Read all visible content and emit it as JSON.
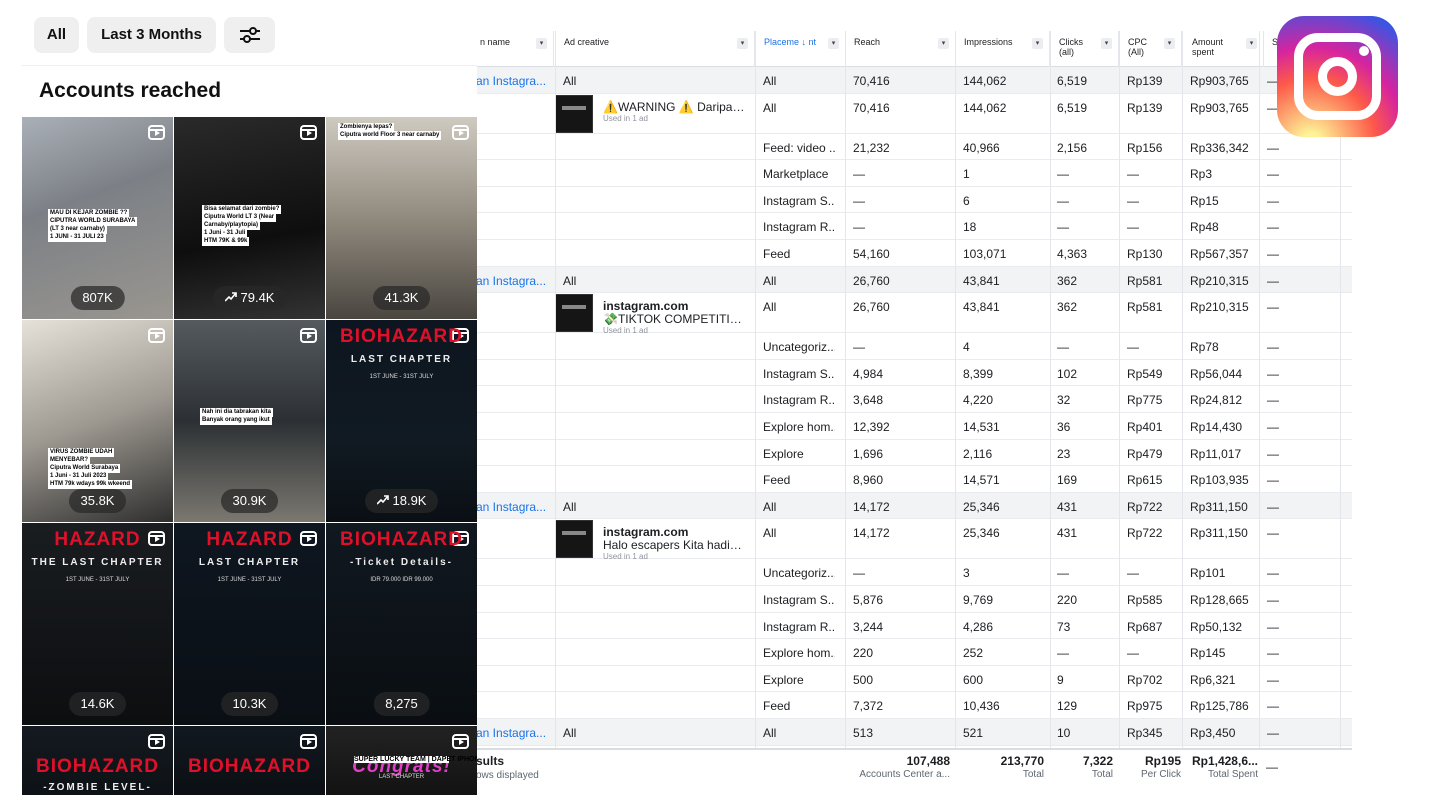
{
  "filters": {
    "all_label": "All",
    "range_label": "Last 3 Months",
    "filter_icon": "sliders-icon"
  },
  "insights": {
    "title": "Accounts reached",
    "tiles": [
      {
        "count": "807K",
        "trend": false,
        "captions": [
          "MAU DI KEJAR ZOMBIE ??",
          "CIPUTRA WORLD SURABAYA",
          "(LT 3 near carnaby)",
          "1 JUNI - 31 JULI 23"
        ]
      },
      {
        "count": "79.4K",
        "trend": true,
        "captions": [
          "Bisa selamat dari zombie?",
          "Ciputra World LT 3 (Near",
          "Carnaby/playtopia)",
          "1 Juni - 31 Juli",
          "HTM 79K & 99k"
        ]
      },
      {
        "count": "41.3K",
        "trend": false,
        "captions": [
          "Zombienya lepas?",
          "Ciputra world Floor 3 near carnaby"
        ]
      },
      {
        "count": "35.8K",
        "trend": false,
        "captions": [
          "VIRUS ZOMBIE UDAH",
          "MENYEBAR?",
          "Ciputra World Surabaya",
          "1 Juni - 31 Juli 2023",
          "HTM 79k wdays 99k wkeend"
        ]
      },
      {
        "count": "30.9K",
        "trend": false,
        "captions": [
          "Nah ini dia tabrakan kita",
          "Banyak orang yang ikut"
        ]
      },
      {
        "count": "18.9K",
        "trend": true,
        "title": "BIOHAZARD",
        "subtitle": "LAST CHAPTER",
        "tiny": "1ST JUNE - 31ST JULY"
      },
      {
        "count": "14.6K",
        "trend": false,
        "title": "HAZARD",
        "subtitle": "THE LAST CHAPTER",
        "tiny": "1ST JUNE - 31ST JULY"
      },
      {
        "count": "10.3K",
        "trend": false,
        "title": "HAZARD",
        "subtitle": "LAST CHAPTER",
        "tiny": "1ST JUNE - 31ST JULY"
      },
      {
        "count": "8,275",
        "trend": false,
        "title": "BIOHAZARD",
        "subtitle": "-Ticket Details-",
        "tiny": "IDR 79.000  IDR 99.000"
      },
      {
        "count": "",
        "trend": false,
        "title": "BIOHAZARD",
        "subtitle": "-ZOMBIE LEVEL-"
      },
      {
        "count": "",
        "trend": false,
        "title": "BIOHAZARD",
        "subtitle": ""
      },
      {
        "count": "",
        "trend": false,
        "title": "Congrats!",
        "subtitle": "SUPER LUCKY TEAM | DAPET IPHONE",
        "tiny": "LAST CHAPTER"
      }
    ]
  },
  "ads_table": {
    "headers": {
      "campaign": "n name",
      "creative": "Ad creative",
      "placement": "Placeme ↓ nt",
      "reach": "Reach",
      "impressions": "Impressions",
      "clicks": "Clicks (all)",
      "cpc": "CPC (All)",
      "amount": "Amount spent",
      "more": "Se"
    },
    "groups": [
      {
        "campaign": "an Instagra...",
        "creative_title": "⚠️WARNING ⚠️ Daripad...",
        "creative_body": "",
        "used": "Used in 1 ad",
        "rows": [
          {
            "p": "All",
            "reach": "70,416",
            "impr": "144,062",
            "clicks": "6,519",
            "cpc": "Rp139",
            "amt": "Rp903,765",
            "s": "—",
            "group": true,
            "creative_all": "All"
          },
          {
            "p": "All",
            "reach": "70,416",
            "impr": "144,062",
            "clicks": "6,519",
            "cpc": "Rp139",
            "amt": "Rp903,765",
            "s": "—"
          },
          {
            "p": "Feed: video ...",
            "reach": "21,232",
            "impr": "40,966",
            "clicks": "2,156",
            "cpc": "Rp156",
            "amt": "Rp336,342",
            "s": "—"
          },
          {
            "p": "Marketplace",
            "reach": "—",
            "impr": "1",
            "clicks": "—",
            "cpc": "—",
            "amt": "Rp3",
            "s": "—"
          },
          {
            "p": "Instagram S...",
            "reach": "—",
            "impr": "6",
            "clicks": "—",
            "cpc": "—",
            "amt": "Rp15",
            "s": "—"
          },
          {
            "p": "Instagram R...",
            "reach": "—",
            "impr": "18",
            "clicks": "—",
            "cpc": "—",
            "amt": "Rp48",
            "s": "—"
          },
          {
            "p": "Feed",
            "reach": "54,160",
            "impr": "103,071",
            "clicks": "4,363",
            "cpc": "Rp130",
            "amt": "Rp567,357",
            "s": "—"
          }
        ]
      },
      {
        "campaign": "an Instagra...",
        "creative_title": "instagram.com",
        "creative_body": "💸TIKTOK COMPETITIO...",
        "used": "Used in 1 ad",
        "rows": [
          {
            "p": "All",
            "reach": "26,760",
            "impr": "43,841",
            "clicks": "362",
            "cpc": "Rp581",
            "amt": "Rp210,315",
            "s": "—",
            "group": true,
            "creative_all": "All"
          },
          {
            "p": "All",
            "reach": "26,760",
            "impr": "43,841",
            "clicks": "362",
            "cpc": "Rp581",
            "amt": "Rp210,315",
            "s": "—"
          },
          {
            "p": "Uncategoriz...",
            "reach": "—",
            "impr": "4",
            "clicks": "—",
            "cpc": "—",
            "amt": "Rp78",
            "s": "—"
          },
          {
            "p": "Instagram S...",
            "reach": "4,984",
            "impr": "8,399",
            "clicks": "102",
            "cpc": "Rp549",
            "amt": "Rp56,044",
            "s": "—"
          },
          {
            "p": "Instagram R...",
            "reach": "3,648",
            "impr": "4,220",
            "clicks": "32",
            "cpc": "Rp775",
            "amt": "Rp24,812",
            "s": "—"
          },
          {
            "p": "Explore hom...",
            "reach": "12,392",
            "impr": "14,531",
            "clicks": "36",
            "cpc": "Rp401",
            "amt": "Rp14,430",
            "s": "—"
          },
          {
            "p": "Explore",
            "reach": "1,696",
            "impr": "2,116",
            "clicks": "23",
            "cpc": "Rp479",
            "amt": "Rp11,017",
            "s": "—"
          },
          {
            "p": "Feed",
            "reach": "8,960",
            "impr": "14,571",
            "clicks": "169",
            "cpc": "Rp615",
            "amt": "Rp103,935",
            "s": "—"
          }
        ]
      },
      {
        "campaign": "an Instagra...",
        "creative_title": "instagram.com",
        "creative_body": "Halo escapers Kita hadir ...",
        "used": "Used in 1 ad",
        "rows": [
          {
            "p": "All",
            "reach": "14,172",
            "impr": "25,346",
            "clicks": "431",
            "cpc": "Rp722",
            "amt": "Rp311,150",
            "s": "—",
            "group": true,
            "creative_all": "All"
          },
          {
            "p": "All",
            "reach": "14,172",
            "impr": "25,346",
            "clicks": "431",
            "cpc": "Rp722",
            "amt": "Rp311,150",
            "s": "—"
          },
          {
            "p": "Uncategoriz...",
            "reach": "—",
            "impr": "3",
            "clicks": "—",
            "cpc": "—",
            "amt": "Rp101",
            "s": "—"
          },
          {
            "p": "Instagram S...",
            "reach": "5,876",
            "impr": "9,769",
            "clicks": "220",
            "cpc": "Rp585",
            "amt": "Rp128,665",
            "s": "—"
          },
          {
            "p": "Instagram R...",
            "reach": "3,244",
            "impr": "4,286",
            "clicks": "73",
            "cpc": "Rp687",
            "amt": "Rp50,132",
            "s": "—"
          },
          {
            "p": "Explore hom...",
            "reach": "220",
            "impr": "252",
            "clicks": "—",
            "cpc": "—",
            "amt": "Rp145",
            "s": "—"
          },
          {
            "p": "Explore",
            "reach": "500",
            "impr": "600",
            "clicks": "9",
            "cpc": "Rp702",
            "amt": "Rp6,321",
            "s": "—"
          },
          {
            "p": "Feed",
            "reach": "7,372",
            "impr": "10,436",
            "clicks": "129",
            "cpc": "Rp975",
            "amt": "Rp125,786",
            "s": "—"
          }
        ]
      },
      {
        "campaign": "an Instagra...",
        "creative_title": "",
        "creative_body": "",
        "used": "",
        "rows": [
          {
            "p": "All",
            "reach": "513",
            "impr": "521",
            "clicks": "10",
            "cpc": "Rp345",
            "amt": "Rp3,450",
            "s": "—",
            "group": true,
            "creative_all": "All"
          }
        ]
      }
    ],
    "footer": {
      "label": "sults",
      "sublabel": "ows displayed",
      "reach": "107,488",
      "reach_sub": "Accounts Center a...",
      "impr": "213,770",
      "impr_sub": "Total",
      "clicks": "7,322",
      "clicks_sub": "Total",
      "cpc": "Rp195",
      "cpc_sub": "Per Click",
      "amt": "Rp1,428,6...",
      "amt_sub": "Total Spent",
      "s": "—"
    }
  },
  "logo": {
    "name": "instagram-logo-icon"
  }
}
